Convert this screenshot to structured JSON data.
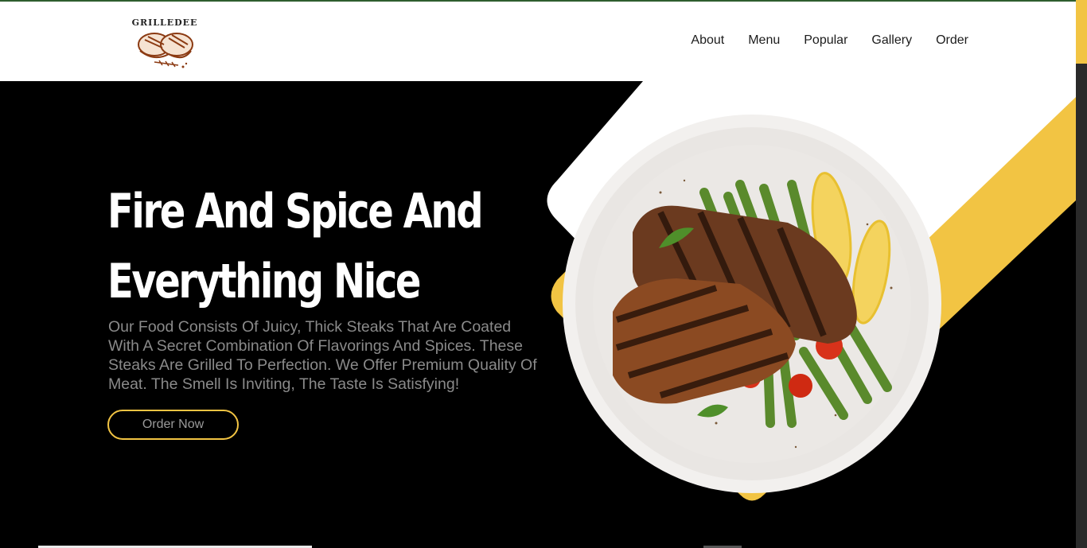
{
  "logo": {
    "text": "GRILLEDEE"
  },
  "nav": {
    "items": [
      {
        "label": "About"
      },
      {
        "label": "Menu"
      },
      {
        "label": "Popular"
      },
      {
        "label": "Gallery"
      },
      {
        "label": "Order"
      }
    ]
  },
  "hero": {
    "headline_line1": "Fire And Spice And",
    "headline_line2": "Everything Nice",
    "description": "Our Food Consists Of Juicy, Thick Steaks That Are Coated With A Secret Combination Of Flavorings And Spices. These Steaks Are Grilled To Perfection. We Offer Premium Quality Of Meat. The Smell Is Inviting, The Taste Is Satisfying!",
    "cta_label": "Order Now"
  },
  "colors": {
    "accent": "#f2c443",
    "background": "#000000",
    "header_bg": "#ffffff",
    "top_line": "#2e5e2e"
  },
  "icons": [
    "steak-logo-icon",
    "steak-plate-image"
  ]
}
